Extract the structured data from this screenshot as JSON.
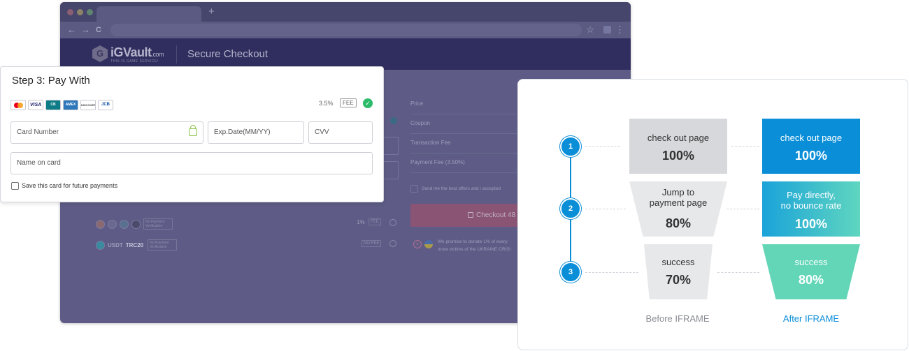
{
  "browser": {
    "new_tab_symbol": "+",
    "nav_back": "←",
    "nav_forward": "→",
    "nav_reload": "C",
    "star_symbol": "☆",
    "menu_symbol": "⋮"
  },
  "site": {
    "logo_mark": "G",
    "logo_text": "iGVault",
    "logo_suffix": ".com",
    "logo_tagline": "THIS IS GAME SERVICE!",
    "header_title": "Secure Checkout"
  },
  "order_summary": {
    "price_label": "Price",
    "coupon_label": "Coupon",
    "transaction_fee_label": "Transaction Fee",
    "payment_fee_label": "Payment Fee (3.50%)",
    "offers_text": "Send me the best offers and i accepted",
    "checkout_label": "Checkout 48",
    "donation_text_1": "We promise to donate 1% of every",
    "donation_text_2": "more victims of the UKRAINE CRISI"
  },
  "crypto_methods": [
    {
      "tag": "No Payment Verification",
      "fee": "1%",
      "fee_tag": "FEE"
    },
    {
      "name": "USDT",
      "network": "TRC20",
      "tag": "No Payment Verification",
      "fee_tag": "NO FEE"
    }
  ],
  "payment": {
    "title": "Step 3: Pay With",
    "brands": [
      "mastercard-icon",
      "visa-icon",
      "cb-icon",
      "amex-icon",
      "discover-icon",
      "jcb-icon"
    ],
    "visa_text": "VISA",
    "cb_text": "CB",
    "amex_text": "AMEX",
    "discover_text": "DISCOVER",
    "jcb_text": "JCB",
    "fee_percent": "3.5%",
    "fee_tag": "FEE",
    "card_number_placeholder": "Card Number",
    "exp_placeholder": "Exp.Date(MM/YY)",
    "cvv_placeholder": "CVV",
    "name_placeholder": "Name on card",
    "save_label": "Save this card for future payments"
  },
  "funnel": {
    "steps": [
      "1",
      "2",
      "3"
    ],
    "before": [
      {
        "label": "check out page",
        "value": "100%"
      },
      {
        "label": "Jump to payment page",
        "label_line1": "Jump to",
        "label_line2": "payment page",
        "value": "80%"
      },
      {
        "label": "success",
        "value": "70%"
      }
    ],
    "after": [
      {
        "label": "check out page",
        "value": "100%"
      },
      {
        "label": "Pay directly, no bounce rate",
        "label_line1": "Pay directly,",
        "label_line2": "no bounce rate",
        "value": "100%"
      },
      {
        "label": "success",
        "value": "80%"
      }
    ],
    "before_caption": "Before IFRAME",
    "after_caption": "After IFRAME",
    "colors": {
      "accent": "#0a8ed8",
      "teal": "#63d6b8",
      "gray": "#d6d8dc"
    }
  }
}
